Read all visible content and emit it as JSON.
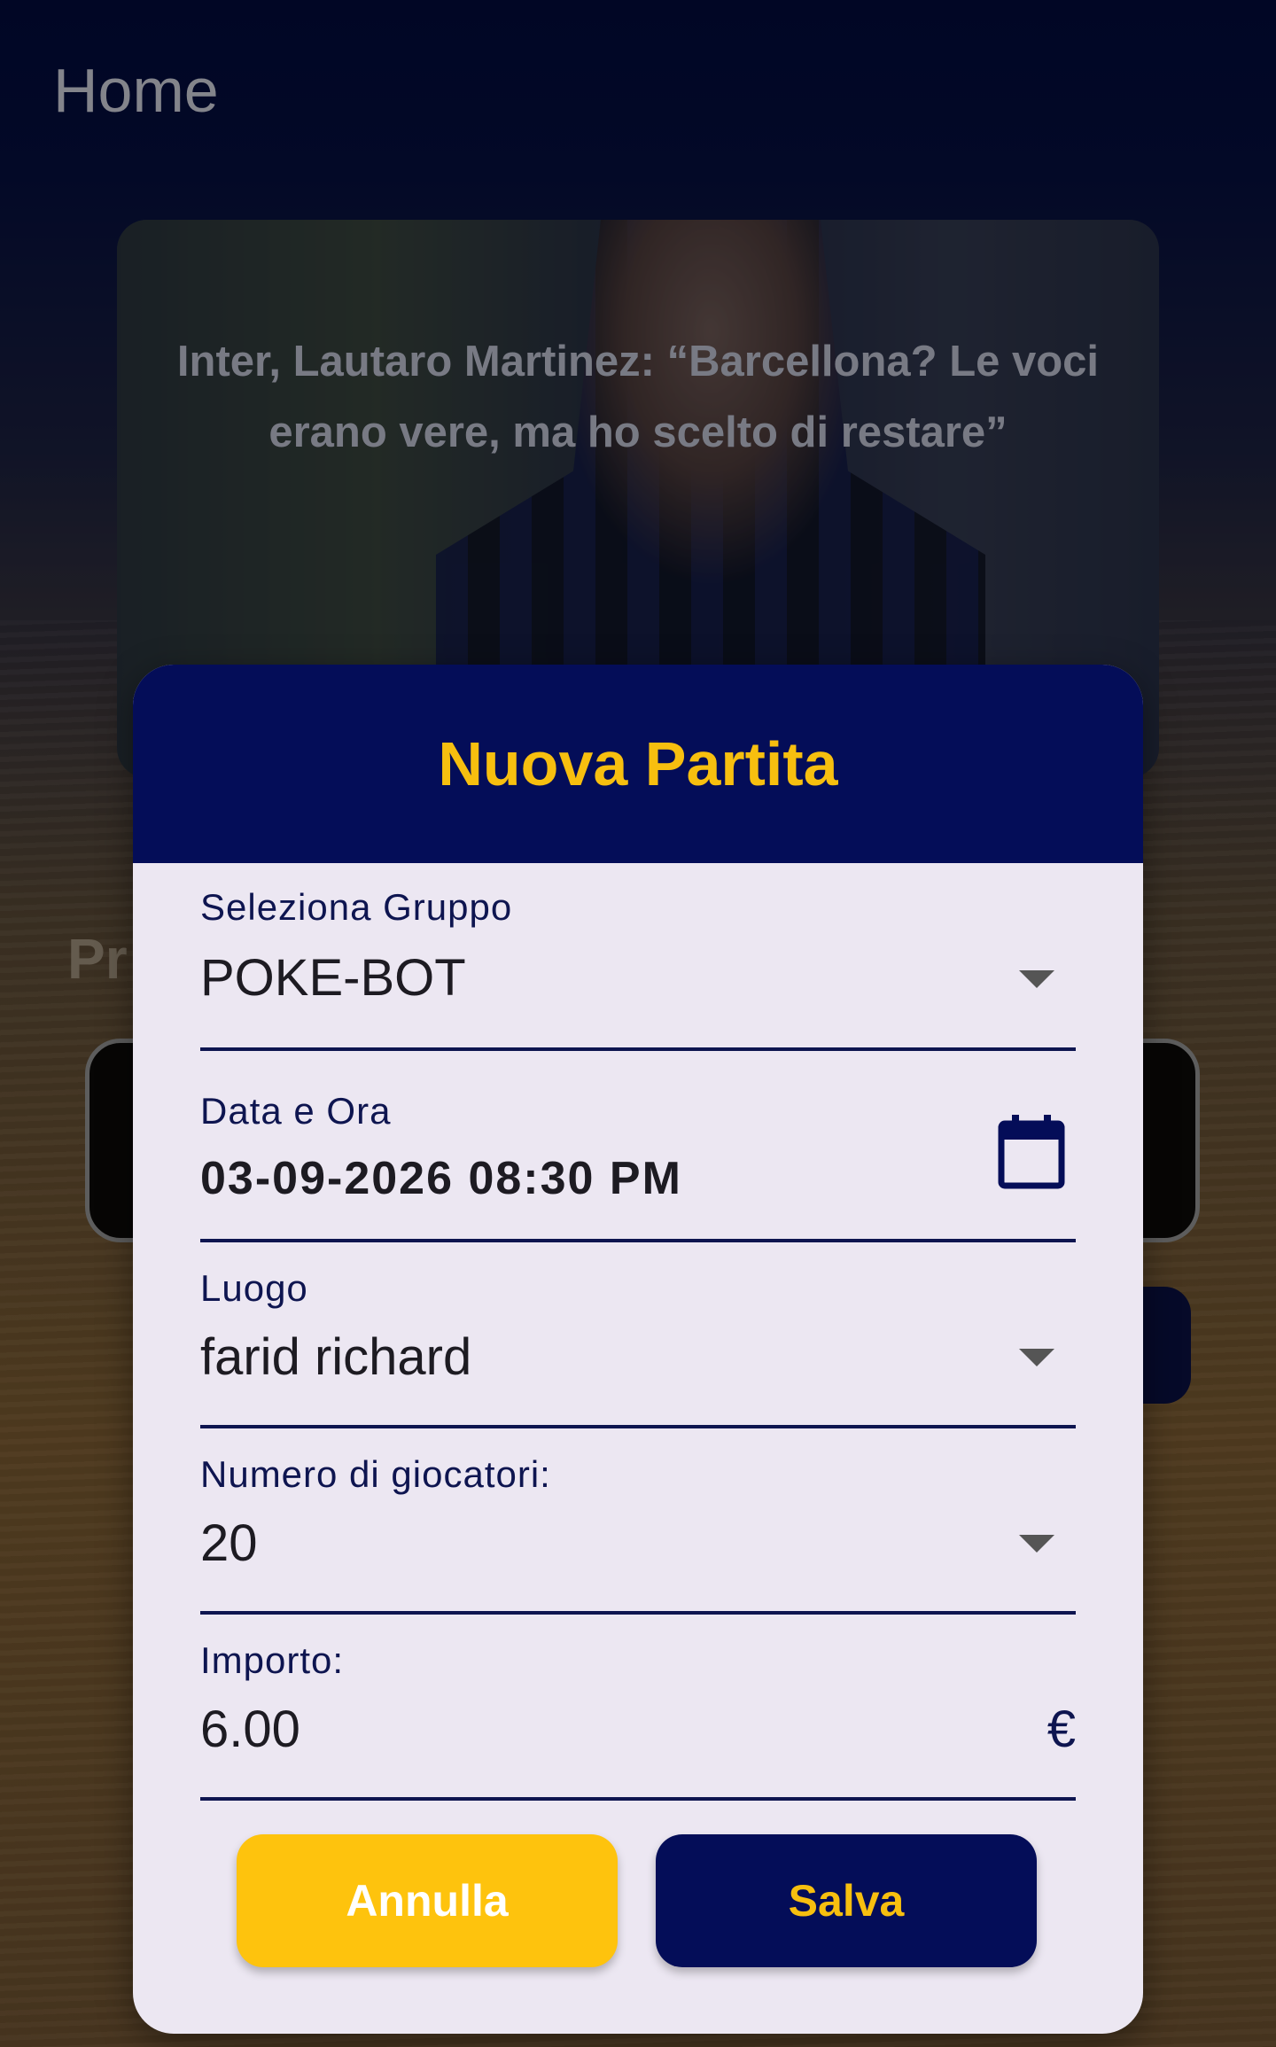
{
  "app": {
    "title": "Home"
  },
  "news": {
    "headline": "Inter, Lautaro Martinez: “Barcellona? Le voci erano vere, ma ho scelto di restare”"
  },
  "background": {
    "section_title_partial": "Pr"
  },
  "dialog": {
    "title": "Nuova Partita",
    "fields": {
      "group": {
        "label": "Seleziona Gruppo",
        "value": "POKE-BOT"
      },
      "datetime": {
        "label": "Data e Ora",
        "value": "03-09-2026 08:30 PM"
      },
      "location": {
        "label": "Luogo",
        "value": "farid richard"
      },
      "players": {
        "label": "Numero di giocatori:",
        "value": "20"
      },
      "amount": {
        "label": "Importo:",
        "value": "6.00",
        "suffix": "€"
      }
    },
    "buttons": {
      "cancel": "Annulla",
      "save": "Salva"
    }
  },
  "colors": {
    "primary": "#040d58",
    "accent": "#f7bf0f",
    "dialog_bg": "#ece7f2"
  },
  "icons": {
    "dropdown": "caret-down-icon",
    "calendar": "calendar-icon"
  }
}
